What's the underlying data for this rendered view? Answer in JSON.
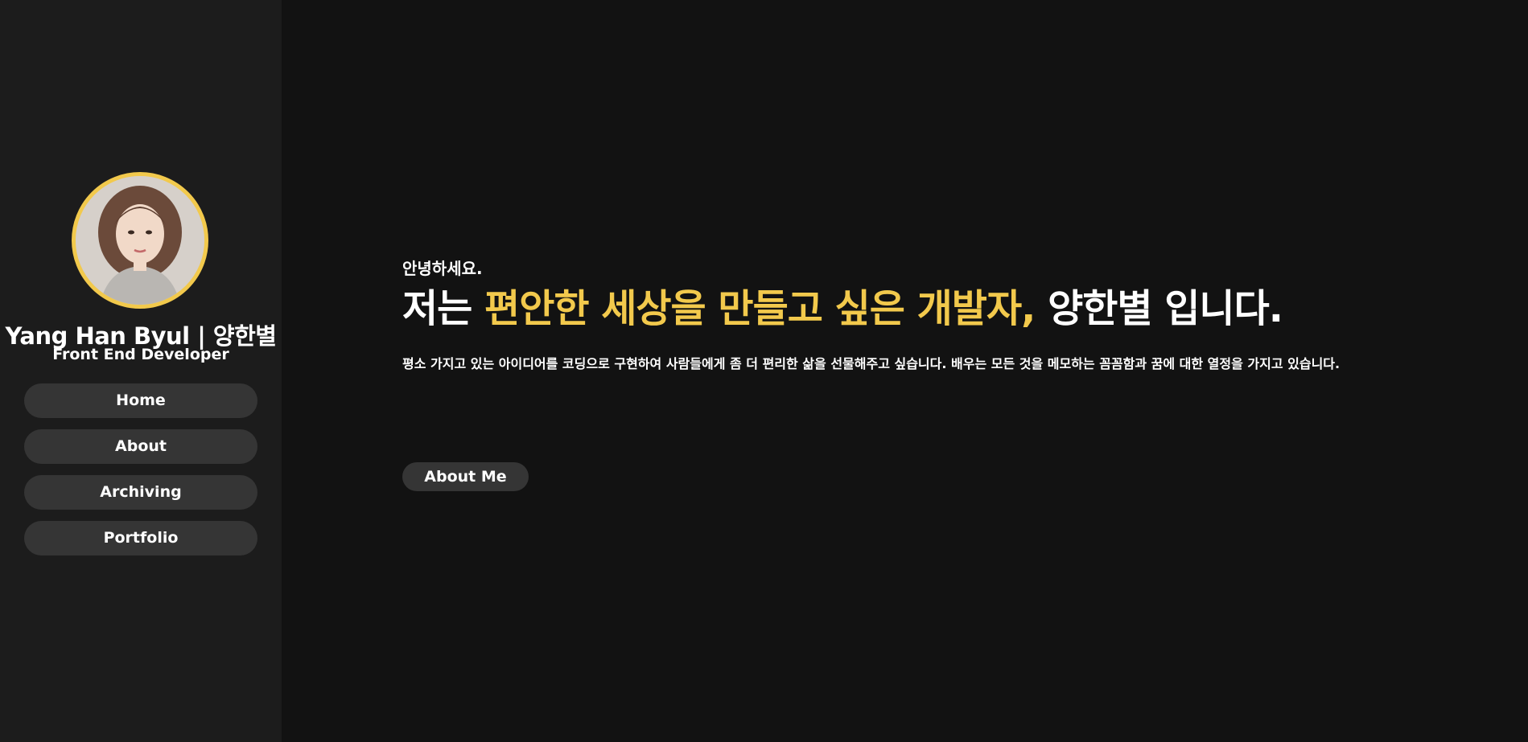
{
  "sidebar": {
    "profile": {
      "name": "Yang Han Byul | 양한별",
      "role": "Front End Developer"
    },
    "nav": [
      {
        "label": "Home"
      },
      {
        "label": "About"
      },
      {
        "label": "Archiving"
      },
      {
        "label": "Portfolio"
      }
    ]
  },
  "main": {
    "greeting": "안녕하세요.",
    "headline": {
      "prefix": "저는 ",
      "highlight": "편안한 세상을 만들고 싶은 개발자,",
      "suffix": " 양한별 입니다."
    },
    "intro": "평소 가지고 있는 아이디어를 코딩으로 구현하여 사람들에게 좀 더 편리한 삶을 선물해주고 싶습니다. 배우는 모든 것을 메모하는 꼼꼼함과 꿈에 대한 열정을 가지고 있습니다.",
    "cta_label": "About Me"
  },
  "colors": {
    "background": "#121212",
    "sidebar_background": "#1c1c1c",
    "accent": "#f2c94c",
    "button_background": "#353535",
    "text": "#ffffff"
  }
}
